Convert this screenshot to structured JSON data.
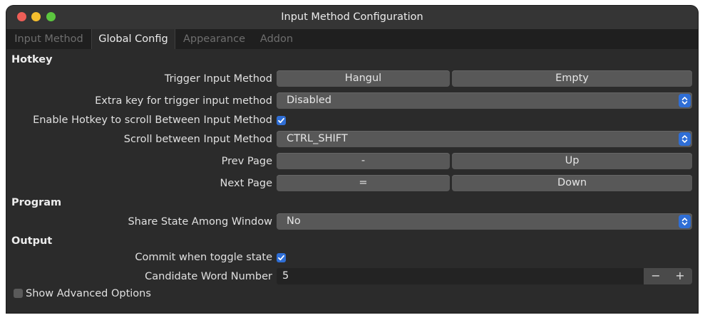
{
  "window": {
    "title": "Input Method Configuration"
  },
  "tabs": [
    {
      "label": "Input Method",
      "active": false
    },
    {
      "label": "Global Config",
      "active": true
    },
    {
      "label": "Appearance",
      "active": false
    },
    {
      "label": "Addon",
      "active": false
    }
  ],
  "sections": {
    "hotkey": "Hotkey",
    "program": "Program",
    "output": "Output"
  },
  "hotkey": {
    "trigger": {
      "label": "Trigger Input Method",
      "key1": "Hangul",
      "key2": "Empty"
    },
    "extra_key": {
      "label": "Extra key for trigger input method",
      "value": "Disabled"
    },
    "enable_scroll": {
      "label": "Enable Hotkey to scroll Between Input Method",
      "checked": true
    },
    "scroll": {
      "label": "Scroll between Input Method",
      "value": "CTRL_SHIFT"
    },
    "prev_page": {
      "label": "Prev Page",
      "key1": "-",
      "key2": "Up"
    },
    "next_page": {
      "label": "Next Page",
      "key1": "=",
      "key2": "Down"
    }
  },
  "program": {
    "share_state": {
      "label": "Share State Among Window",
      "value": "No"
    }
  },
  "output": {
    "commit_toggle": {
      "label": "Commit when toggle state",
      "checked": true
    },
    "candidate_number": {
      "label": "Candidate Word Number",
      "value": "5",
      "minus": "−",
      "plus": "+"
    }
  },
  "advanced": {
    "label": "Show Advanced Options",
    "checked": false
  },
  "colors": {
    "accent": "#2f6ed5",
    "window_bg": "#2b2b2b",
    "button_bg": "#585858"
  }
}
